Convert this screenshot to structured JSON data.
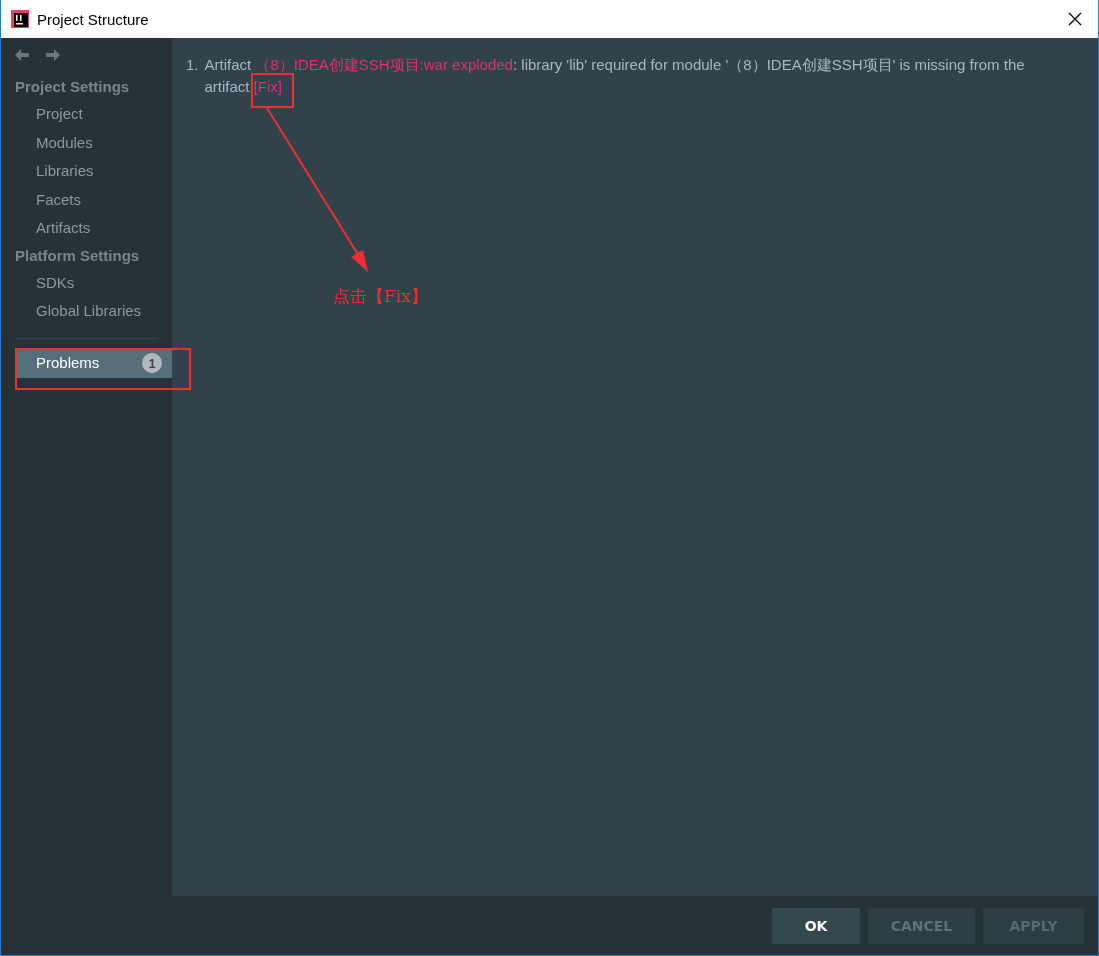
{
  "window": {
    "title": "Project Structure"
  },
  "sidebar": {
    "sections": [
      {
        "title": "Project Settings",
        "items": [
          {
            "label": "Project",
            "selected": false
          },
          {
            "label": "Modules",
            "selected": false
          },
          {
            "label": "Libraries",
            "selected": false
          },
          {
            "label": "Facets",
            "selected": false
          },
          {
            "label": "Artifacts",
            "selected": false
          }
        ]
      },
      {
        "title": "Platform Settings",
        "items": [
          {
            "label": "SDKs",
            "selected": false
          },
          {
            "label": "Global Libraries",
            "selected": false
          }
        ]
      }
    ],
    "problems_item": {
      "label": "Problems",
      "count": "1",
      "selected": true
    }
  },
  "problems": [
    {
      "number": "1.",
      "parts": [
        {
          "kind": "text",
          "text": "Artifact "
        },
        {
          "kind": "link",
          "text": "（8）IDEA创建SSH项目:war exploded"
        },
        {
          "kind": "text",
          "text": ": library 'lib' required for module '（8）IDEA创建SSH项目' is missing from the artifact "
        },
        {
          "kind": "link",
          "text": "[Fix]",
          "highlighted": true
        }
      ]
    }
  ],
  "annotation": {
    "caption": "点击【Fix】"
  },
  "buttons": [
    {
      "label": "OK",
      "kind": "default",
      "disabled": false
    },
    {
      "label": "CANCEL",
      "kind": "normal",
      "disabled": false
    },
    {
      "label": "APPLY",
      "kind": "normal",
      "disabled": true
    }
  ]
}
